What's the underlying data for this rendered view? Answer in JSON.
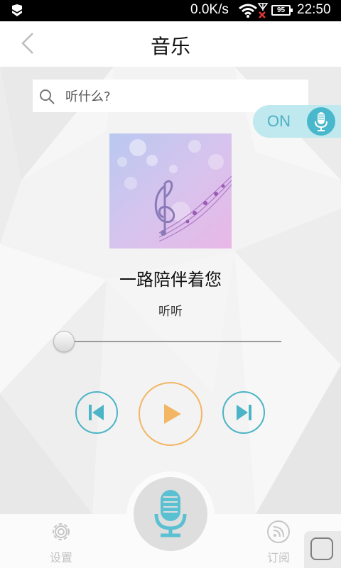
{
  "status_bar": {
    "speed": "0.0K/s",
    "battery": "95",
    "time": "22:50"
  },
  "header": {
    "title": "音乐",
    "back_icon": "chevron-left-icon"
  },
  "search": {
    "placeholder": "听什么?",
    "icon": "search-icon"
  },
  "voice_toggle": {
    "label": "ON",
    "state": "on",
    "icon": "microphone-icon"
  },
  "player": {
    "title": "一路陪伴着您",
    "artist": "听听",
    "progress": 0.0,
    "controls": {
      "prev_icon": "skip-previous-icon",
      "play_icon": "play-icon",
      "next_icon": "skip-next-icon"
    }
  },
  "bottom_nav": {
    "settings_label": "设置",
    "subscribe_label": "订阅",
    "mic_icon": "microphone-icon"
  },
  "colors": {
    "accent_teal": "#4bb4c6",
    "accent_orange": "#f2b664",
    "toggle_bg": "#bfe9ee"
  }
}
